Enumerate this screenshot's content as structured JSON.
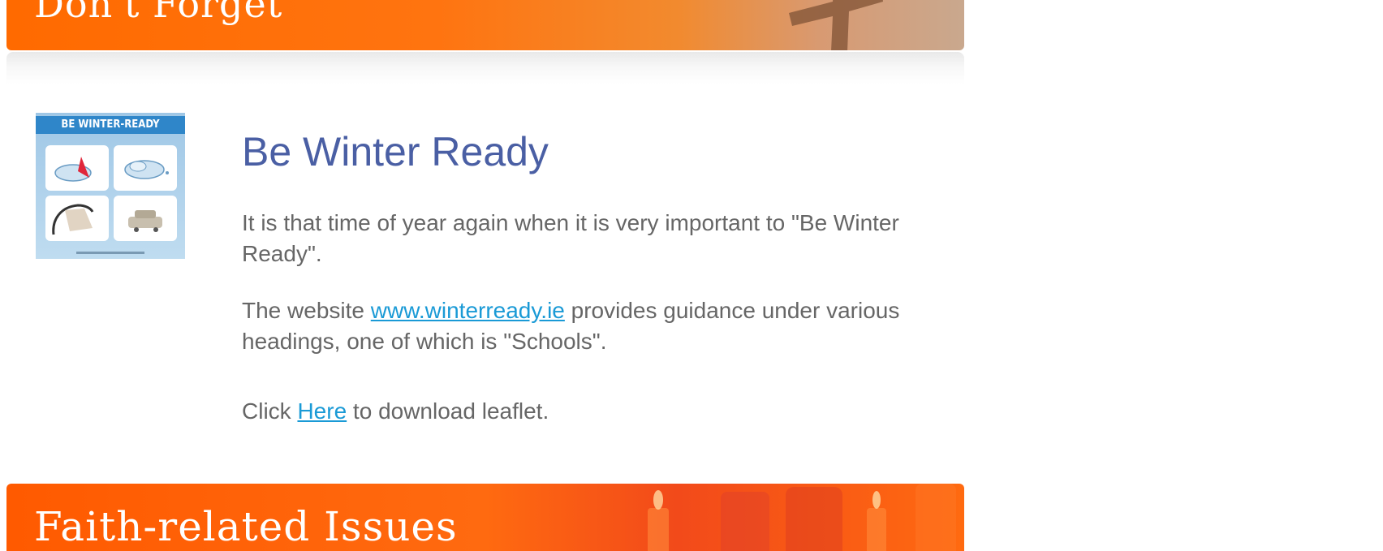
{
  "banners": {
    "top_title": "Don't Forget",
    "bottom_title": "Faith-related Issues"
  },
  "leaflet": {
    "title": "BE WINTER-READY",
    "tiles": [
      {
        "icon": "cloud-compass-icon"
      },
      {
        "icon": "cloud-icon"
      },
      {
        "icon": "bare-tree-icon"
      },
      {
        "icon": "car-icon"
      }
    ]
  },
  "article": {
    "heading": "Be Winter Ready",
    "para1": "It is that time of year again when it is very important to \"Be Winter Ready\".",
    "para2_before": "The website ",
    "para2_link": "www.winterready.ie",
    "para2_after": " provides guidance under various headings, one of which is \"Schools\".",
    "para3_before": "Click ",
    "para3_link": "Here",
    "para3_after": " to download leaflet."
  },
  "colors": {
    "banner_orange": "#ff6a00",
    "heading_blue": "#4a5fa4",
    "body_gray": "#666666",
    "link_blue": "#1a9ad6"
  }
}
